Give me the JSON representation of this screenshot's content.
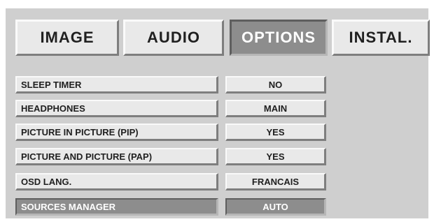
{
  "tabs": [
    {
      "label": "IMAGE",
      "active": false
    },
    {
      "label": "AUDIO",
      "active": false
    },
    {
      "label": "OPTIONS",
      "active": true
    },
    {
      "label": "INSTAL.",
      "active": false
    }
  ],
  "settings": [
    {
      "label": "SLEEP TIMER",
      "value": "NO",
      "selected": false
    },
    {
      "label": "HEADPHONES",
      "value": "MAIN",
      "selected": false
    },
    {
      "label": "PICTURE IN PICTURE (PIP)",
      "value": "YES",
      "selected": false
    },
    {
      "label": "PICTURE AND PICTURE (PAP)",
      "value": "YES",
      "selected": false
    },
    {
      "label": "OSD LANG.",
      "value": "FRANCAIS",
      "selected": false
    },
    {
      "label": "SOURCES MANAGER",
      "value": "AUTO",
      "selected": true
    }
  ],
  "colors": {
    "panel_background": "#cfcfcf",
    "item_background": "#e9e9e9",
    "active_background": "#8d8d8d",
    "active_text": "#ffffff",
    "text": "#202020"
  }
}
